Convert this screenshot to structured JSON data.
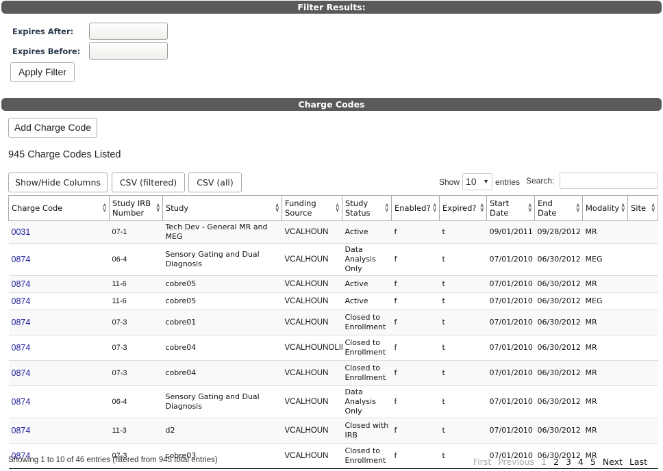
{
  "filter": {
    "title": "Filter Results:",
    "expires_after_label": "Expires After:",
    "expires_after_value": "",
    "expires_before_label": "Expires Before:",
    "expires_before_value": "",
    "apply_label": "Apply Filter"
  },
  "charge_codes": {
    "title": "Charge Codes",
    "add_label": "Add Charge Code",
    "count_text": "945 Charge Codes Listed",
    "toolbar": {
      "show_hide_label": "Show/Hide Columns",
      "csv_filtered_label": "CSV (filtered)",
      "csv_all_label": "CSV (all)"
    },
    "length": {
      "show_label": "Show",
      "selected": "10",
      "entries_label": "entries"
    },
    "search": {
      "label": "Search:",
      "value": ""
    },
    "columns": [
      "Charge Code",
      "Study IRB Number",
      "Study",
      "Funding Source",
      "Study Status",
      "Enabled?",
      "Expired?",
      "Start Date",
      "End Date",
      "Modality",
      "Site"
    ],
    "rows": [
      {
        "code": "0031",
        "irb": "07-1",
        "study": "Tech Dev - General MR and MEG",
        "funding": "VCALHOUN",
        "status": "Active",
        "enabled": "f",
        "expired": "t",
        "start": "09/01/2011",
        "end": "09/28/2012",
        "modality": "MR",
        "site": ""
      },
      {
        "code": "0874",
        "irb": "06-4",
        "study": "Sensory Gating and Dual Diagnosis",
        "funding": "VCALHOUN",
        "status": "Data Analysis Only",
        "enabled": "f",
        "expired": "t",
        "start": "07/01/2010",
        "end": "06/30/2012",
        "modality": "MEG",
        "site": ""
      },
      {
        "code": "0874",
        "irb": "11-6",
        "study": "cobre05",
        "funding": "VCALHOUN",
        "status": "Active",
        "enabled": "f",
        "expired": "t",
        "start": "07/01/2010",
        "end": "06/30/2012",
        "modality": "MR",
        "site": ""
      },
      {
        "code": "0874",
        "irb": "11-6",
        "study": "cobre05",
        "funding": "VCALHOUN",
        "status": "Active",
        "enabled": "f",
        "expired": "t",
        "start": "07/01/2010",
        "end": "06/30/2012",
        "modality": "MEG",
        "site": ""
      },
      {
        "code": "0874",
        "irb": "07-3",
        "study": "cobre01",
        "funding": "VCALHOUN",
        "status": "Closed to Enrollment",
        "enabled": "f",
        "expired": "t",
        "start": "07/01/2010",
        "end": "06/30/2012",
        "modality": "MR",
        "site": ""
      },
      {
        "code": "0874",
        "irb": "07-3",
        "study": "cobre04",
        "funding": "VCALHOUNOLIN",
        "status": "Closed to Enrollment",
        "enabled": "f",
        "expired": "t",
        "start": "07/01/2010",
        "end": "06/30/2012",
        "modality": "MR",
        "site": ""
      },
      {
        "code": "0874",
        "irb": "07-3",
        "study": "cobre04",
        "funding": "VCALHOUN",
        "status": "Closed to Enrollment",
        "enabled": "f",
        "expired": "t",
        "start": "07/01/2010",
        "end": "06/30/2012",
        "modality": "MR",
        "site": ""
      },
      {
        "code": "0874",
        "irb": "06-4",
        "study": "Sensory Gating and Dual Diagnosis",
        "funding": "VCALHOUN",
        "status": "Data Analysis Only",
        "enabled": "f",
        "expired": "t",
        "start": "07/01/2010",
        "end": "06/30/2012",
        "modality": "MR",
        "site": ""
      },
      {
        "code": "0874",
        "irb": "11-3",
        "study": "d2",
        "funding": "VCALHOUN",
        "status": "Closed with IRB",
        "enabled": "f",
        "expired": "t",
        "start": "07/01/2010",
        "end": "06/30/2012",
        "modality": "MR",
        "site": ""
      },
      {
        "code": "0874",
        "irb": "07-3",
        "study": "cobre03",
        "funding": "VCALHOUN",
        "status": "Closed to Enrollment",
        "enabled": "f",
        "expired": "t",
        "start": "07/01/2010",
        "end": "06/30/2012",
        "modality": "MR",
        "site": ""
      }
    ],
    "info_text": "Showing 1 to 10 of 46 entries (filtered from 945 total entries)",
    "pagination": {
      "first": "First",
      "previous": "Previous",
      "pages": [
        "1",
        "2",
        "3",
        "4",
        "5"
      ],
      "current": "1",
      "next": "Next",
      "last": "Last"
    }
  },
  "icons": {
    "sort": "sort-both-icon",
    "dropdown": "caret-down-icon"
  }
}
